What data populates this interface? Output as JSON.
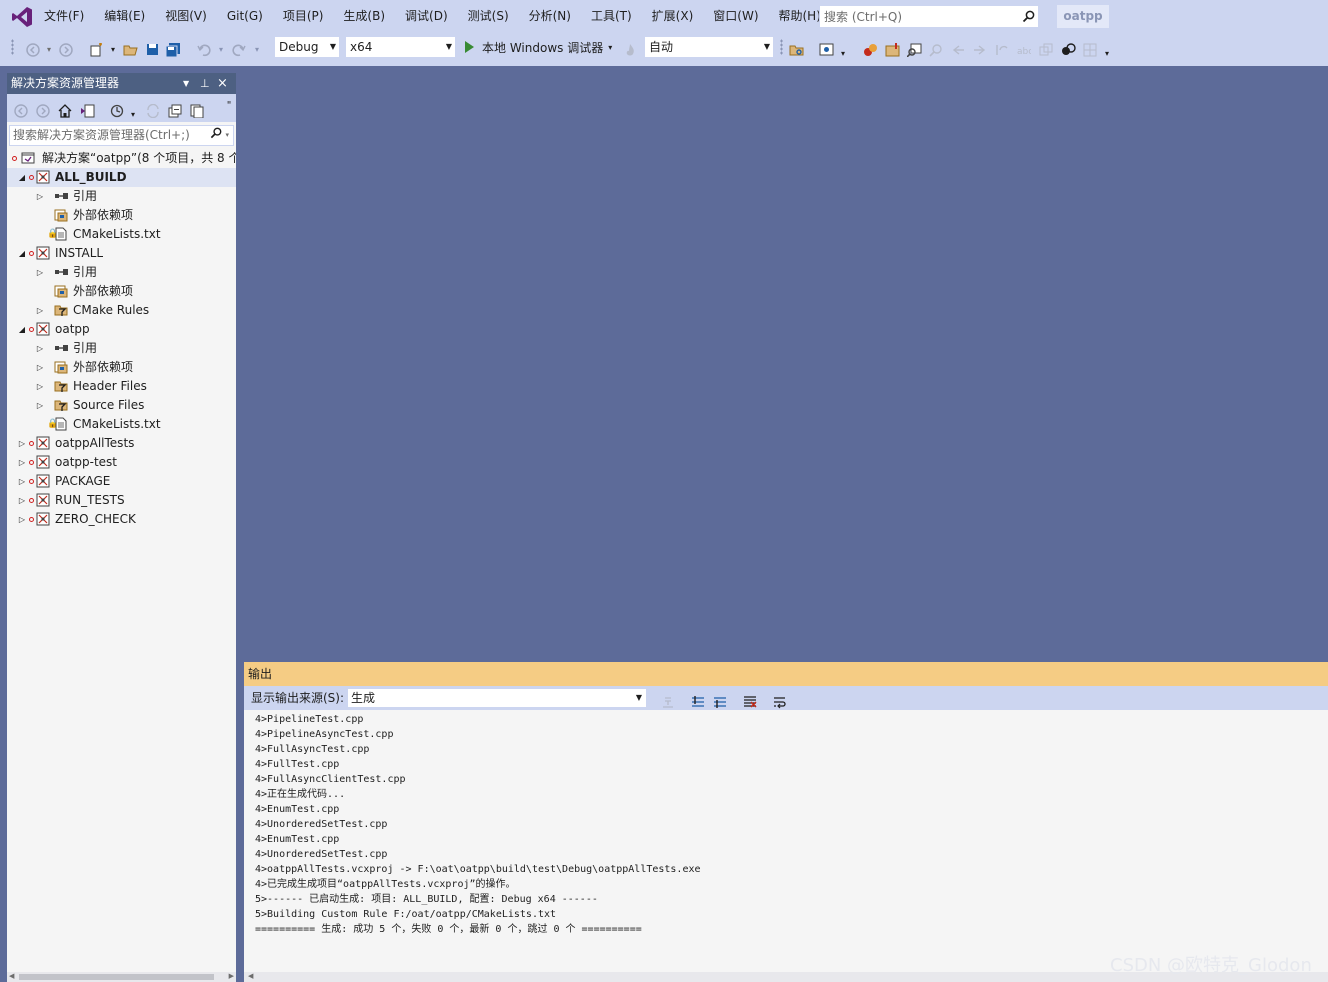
{
  "menu": {
    "items": [
      "文件(F)",
      "编辑(E)",
      "视图(V)",
      "Git(G)",
      "项目(P)",
      "生成(B)",
      "调试(D)",
      "测试(S)",
      "分析(N)",
      "工具(T)",
      "扩展(X)",
      "窗口(W)",
      "帮助(H)"
    ],
    "search_placeholder": "搜索 (Ctrl+Q)",
    "project_name": "oatpp"
  },
  "toolbar": {
    "config": "Debug",
    "platform": "x64",
    "debugger": "本地 Windows 调试器",
    "auto": "自动",
    "debugger_icon": "play-icon"
  },
  "solution_explorer": {
    "title": "解决方案资源管理器",
    "search_placeholder": "搜索解决方案资源管理器(Ctrl+;)",
    "tree": [
      {
        "label": "解决方案“oatpp”(8 个项目，共 8 个",
        "icon": "solution-icon",
        "expander": "",
        "bold": false,
        "red": true
      },
      {
        "label": "ALL_BUILD",
        "icon": "project-icon",
        "expander": "◢",
        "bold": true,
        "red": true,
        "selected": true
      },
      {
        "label": "引用",
        "icon": "references-icon",
        "expander": "▷",
        "bold": false,
        "red": false
      },
      {
        "label": "外部依赖项",
        "icon": "external-deps-icon",
        "expander": "",
        "bold": false,
        "red": false
      },
      {
        "label": "CMakeLists.txt",
        "icon": "file-icon",
        "expander": "",
        "bold": false,
        "red": false,
        "lock": true
      },
      {
        "label": "INSTALL",
        "icon": "project-icon",
        "expander": "◢",
        "bold": false,
        "red": true
      },
      {
        "label": "引用",
        "icon": "references-icon",
        "expander": "▷",
        "bold": false,
        "red": false
      },
      {
        "label": "外部依赖项",
        "icon": "external-deps-icon",
        "expander": "",
        "bold": false,
        "red": false
      },
      {
        "label": "CMake Rules",
        "icon": "filter-icon",
        "expander": "▷",
        "bold": false,
        "red": false
      },
      {
        "label": "oatpp",
        "icon": "project-icon",
        "expander": "◢",
        "bold": false,
        "red": true
      },
      {
        "label": "引用",
        "icon": "references-icon",
        "expander": "▷",
        "bold": false,
        "red": false
      },
      {
        "label": "外部依赖项",
        "icon": "external-deps-icon",
        "expander": "▷",
        "bold": false,
        "red": false
      },
      {
        "label": "Header Files",
        "icon": "filter-icon",
        "expander": "▷",
        "bold": false,
        "red": false
      },
      {
        "label": "Source Files",
        "icon": "filter-icon",
        "expander": "▷",
        "bold": false,
        "red": false
      },
      {
        "label": "CMakeLists.txt",
        "icon": "file-icon",
        "expander": "",
        "bold": false,
        "red": false,
        "lock": true
      },
      {
        "label": "oatppAllTests",
        "icon": "project-icon",
        "expander": "▷",
        "bold": false,
        "red": true
      },
      {
        "label": "oatpp-test",
        "icon": "project-icon",
        "expander": "▷",
        "bold": false,
        "red": true
      },
      {
        "label": "PACKAGE",
        "icon": "project-icon",
        "expander": "▷",
        "bold": false,
        "red": true
      },
      {
        "label": "RUN_TESTS",
        "icon": "project-icon",
        "expander": "▷",
        "bold": false,
        "red": true
      },
      {
        "label": "ZERO_CHECK",
        "icon": "project-icon",
        "expander": "▷",
        "bold": false,
        "red": true
      }
    ]
  },
  "output": {
    "title": "输出",
    "source_label": "显示输出来源(S):",
    "source_value": "生成",
    "lines": [
      "4>PipelineTest.cpp",
      "4>PipelineAsyncTest.cpp",
      "4>FullAsyncTest.cpp",
      "4>FullTest.cpp",
      "4>FullAsyncClientTest.cpp",
      "4>正在生成代码...",
      "4>EnumTest.cpp",
      "4>UnorderedSetTest.cpp",
      "4>EnumTest.cpp",
      "4>UnorderedSetTest.cpp",
      "4>oatppAllTests.vcxproj -> F:\\oat\\oatpp\\build\\test\\Debug\\oatppAllTests.exe",
      "4>已完成生成项目“oatppAllTests.vcxproj”的操作。",
      "5>------ 已启动生成: 项目: ALL_BUILD, 配置: Debug x64 ------",
      "5>Building Custom Rule F:/oat/oatpp/CMakeLists.txt",
      "========== 生成: 成功 5 个，失败 0 个，最新 0 个，跳过 0 个 =========="
    ]
  },
  "watermark": "CSDN @欧特克_Glodon",
  "colors": {
    "workspace": "#5d6b99",
    "chrome": "#ccd5f0",
    "panel_header": "#4d6082",
    "output_header": "#f5cc84",
    "panel_bg": "#f5f5f5"
  }
}
